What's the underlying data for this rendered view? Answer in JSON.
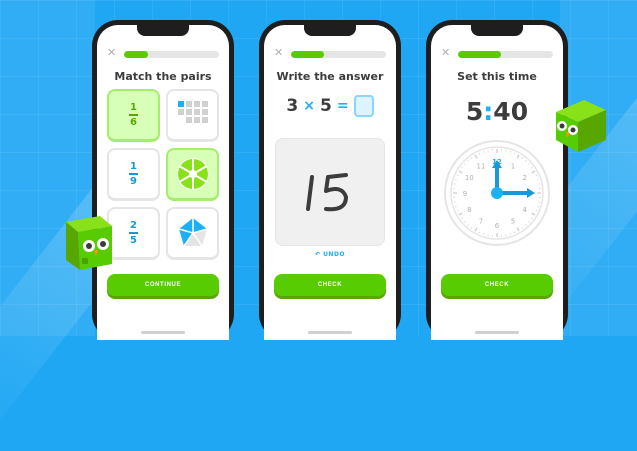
{
  "colors": {
    "background": "#1fa7f4",
    "green": "#58cc02",
    "green_dark": "#58a700",
    "blue": "#1cb0f6",
    "text": "#3c3c3c"
  },
  "phones": [
    {
      "progress": 0.25,
      "title": "Match the pairs",
      "cards": [
        {
          "type": "fraction",
          "numerator": "1",
          "denominator": "6",
          "selected": true
        },
        {
          "type": "grid-icon",
          "selected": false
        },
        {
          "type": "fraction",
          "numerator": "1",
          "denominator": "9",
          "selected": false
        },
        {
          "type": "pie-icon",
          "selected": true
        },
        {
          "type": "fraction",
          "numerator": "2",
          "denominator": "5",
          "selected": false
        },
        {
          "type": "pentagon-icon",
          "selected": false
        }
      ],
      "button_label": "CONTINUE"
    },
    {
      "progress": 0.35,
      "title": "Write the answer",
      "equation": {
        "a": "3",
        "op": "×",
        "b": "5",
        "eq": "="
      },
      "handwritten": "15",
      "undo_label": "UNDO",
      "button_label": "CHECK"
    },
    {
      "progress": 0.45,
      "title": "Set this time",
      "time": {
        "hours": "5",
        "colon": ":",
        "minutes": "40"
      },
      "clock": {
        "numbers": [
          "12",
          "1",
          "2",
          "3",
          "4",
          "5",
          "6",
          "7",
          "8",
          "9",
          "10",
          "11"
        ],
        "hour_hand_points_to": "12",
        "minute_hand_points_to": "3"
      },
      "button_label": "CHECK"
    }
  ]
}
